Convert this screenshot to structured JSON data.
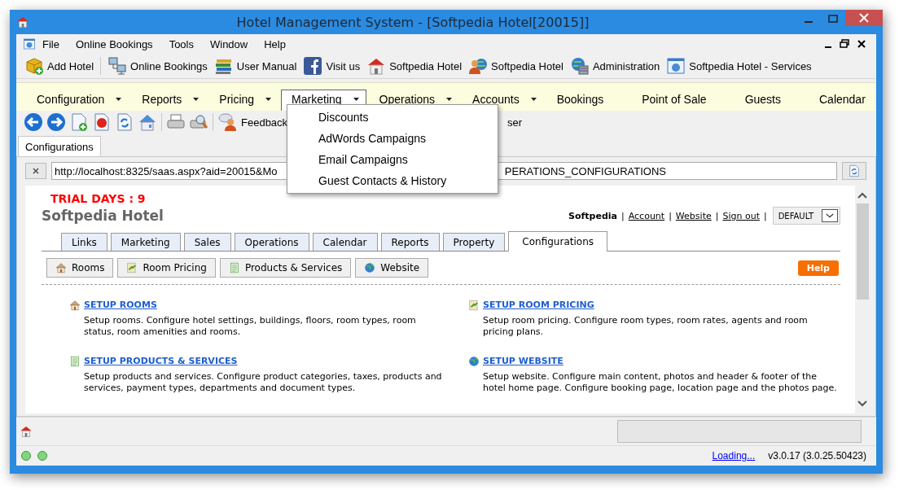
{
  "window": {
    "title": "Hotel Management System - [Softpedia Hotel[20015]]"
  },
  "menu_bar": [
    "File",
    "Online Bookings",
    "Tools",
    "Window",
    "Help"
  ],
  "toolbar": [
    "Add Hotel",
    "Online Bookings",
    "User Manual",
    "Visit us",
    "Softpedia Hotel",
    "Softpedia Hotel",
    "Administration",
    "Softpedia Hotel - Services"
  ],
  "nav": [
    {
      "label": "Configuration",
      "has_menu": true,
      "selected": false
    },
    {
      "label": "Reports",
      "has_menu": true,
      "selected": false
    },
    {
      "label": "Pricing",
      "has_menu": true,
      "selected": false
    },
    {
      "label": "Marketing",
      "has_menu": true,
      "selected": true
    },
    {
      "label": "Operations",
      "has_menu": true,
      "selected": false
    },
    {
      "label": "Accounts",
      "has_menu": true,
      "selected": false
    },
    {
      "label": "Bookings",
      "has_menu": false,
      "selected": false
    },
    {
      "label": "Point of Sale",
      "has_menu": false,
      "selected": false
    },
    {
      "label": "Guests",
      "has_menu": false,
      "selected": false
    },
    {
      "label": "Calendar",
      "has_menu": false,
      "selected": false
    }
  ],
  "dropdown": [
    "Discounts",
    "AdWords Campaigns",
    "Email Campaigns",
    "Guest Contacts & History"
  ],
  "icon_toolbar": {
    "feedback": "Feedback",
    "partial_label": "ser"
  },
  "doc_tabs": [
    {
      "label": "Configurations",
      "selected": true
    }
  ],
  "address": {
    "value_start": "http://localhost:8325/saas.aspx?aid=20015&Mo",
    "value_end": "PERATIONS_CONFIGURATIONS"
  },
  "page": {
    "trial": "TRIAL DAYS : 9",
    "hotel_name": "Softpedia Hotel",
    "user_bar": [
      {
        "text": "Softpedia",
        "kind": "user"
      },
      {
        "text": "|",
        "kind": "sep"
      },
      {
        "text": "Account",
        "kind": "link"
      },
      {
        "text": "|",
        "kind": "sep"
      },
      {
        "text": "Website",
        "kind": "link"
      },
      {
        "text": "|",
        "kind": "sep"
      },
      {
        "text": "Sign out",
        "kind": "link"
      },
      {
        "text": "|",
        "kind": "sep"
      }
    ],
    "theme": "DEFAULT",
    "tabs": [
      {
        "label": "Links",
        "selected": false
      },
      {
        "label": "Marketing",
        "selected": false
      },
      {
        "label": "Sales",
        "selected": false
      },
      {
        "label": "Operations",
        "selected": false
      },
      {
        "label": "Calendar",
        "selected": false
      },
      {
        "label": "Reports",
        "selected": false
      },
      {
        "label": "Property",
        "selected": false
      },
      {
        "label": "Configurations",
        "selected": true
      }
    ],
    "sub_buttons": [
      "Rooms",
      "Room Pricing",
      "Products & Services",
      "Website"
    ],
    "help": "Help",
    "setup": [
      {
        "title": "SETUP ROOMS",
        "description": "Setup rooms. Configure hotel settings, buildings, floors, room types, room status, room amenities and rooms."
      },
      {
        "title": "SETUP ROOM PRICING",
        "description": "Setup room pricing. Configure room types, room rates, agents and room pricing plans."
      },
      {
        "title": "SETUP PRODUCTS & SERVICES",
        "description": "Setup products and services. Configure product categories, taxes, products and services, payment types, departments and document types."
      },
      {
        "title": "SETUP WEBSITE",
        "description": "Setup website. Configure main content, photos and header & footer of the hotel home page. Configure booking page, location page and the photos page."
      }
    ]
  },
  "status": {
    "loading": "Loading...",
    "version": "v3.0.17 (3.0.25.50423)"
  }
}
